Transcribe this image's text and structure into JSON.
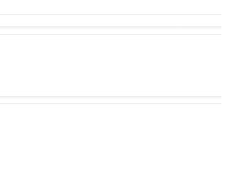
{
  "screen": {
    "background": "#ffffff",
    "divider_color": "#e9e9e9"
  }
}
